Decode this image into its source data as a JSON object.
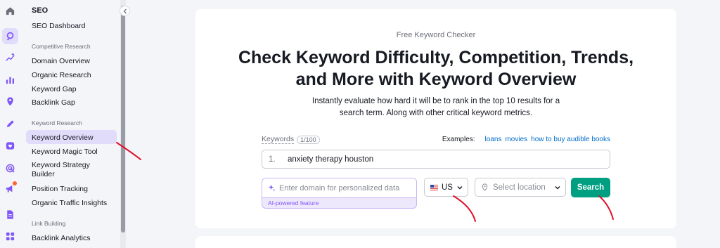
{
  "rail": {
    "icons": [
      "home-icon",
      "seo-icon",
      "ai-sparkle-icon",
      "chart-icon",
      "location-pin-icon",
      "pencil-icon",
      "heart-icon",
      "target-icon",
      "megaphone-icon",
      "document-icon",
      "apps-icon"
    ],
    "active": "seo-icon"
  },
  "sidebar": {
    "title": "SEO",
    "dashboard": "SEO Dashboard",
    "sections": [
      {
        "label": "Competitive Research",
        "items": [
          "Domain Overview",
          "Organic Research",
          "Keyword Gap",
          "Backlink Gap"
        ]
      },
      {
        "label": "Keyword Research",
        "items": [
          "Keyword Overview",
          "Keyword Magic Tool",
          "Keyword Strategy Builder",
          "Position Tracking",
          "Organic Traffic Insights"
        ]
      },
      {
        "label": "Link Building",
        "items": [
          "Backlink Analytics"
        ]
      }
    ],
    "active_item": "Keyword Overview"
  },
  "main": {
    "eyebrow": "Free Keyword Checker",
    "headline_line1": "Check Keyword Difficulty, Competition, Trends,",
    "headline_line2": "and More with Keyword Overview",
    "subtitle_line1": "Instantly evaluate how hard it will be to rank in the top 10 results for a",
    "subtitle_line2": "search term. Along with other critical keyword metrics.",
    "keywords_label": "Keywords",
    "keywords_count": "1/100",
    "examples_label": "Examples:",
    "examples": [
      "loans",
      "movies",
      "how to buy audible books"
    ],
    "keyword_number": "1.",
    "keyword_value": "anxiety therapy houston",
    "domain_placeholder": "Enter domain for personalized data",
    "ai_feature": "AI-powered feature",
    "country": "US",
    "location_placeholder": "Select location",
    "search_label": "Search"
  },
  "colors": {
    "accent": "#7f56f8",
    "active_bg": "#e2dcfb",
    "search_button": "#009f81",
    "link": "#006dca",
    "annotation": "#e0102a"
  }
}
